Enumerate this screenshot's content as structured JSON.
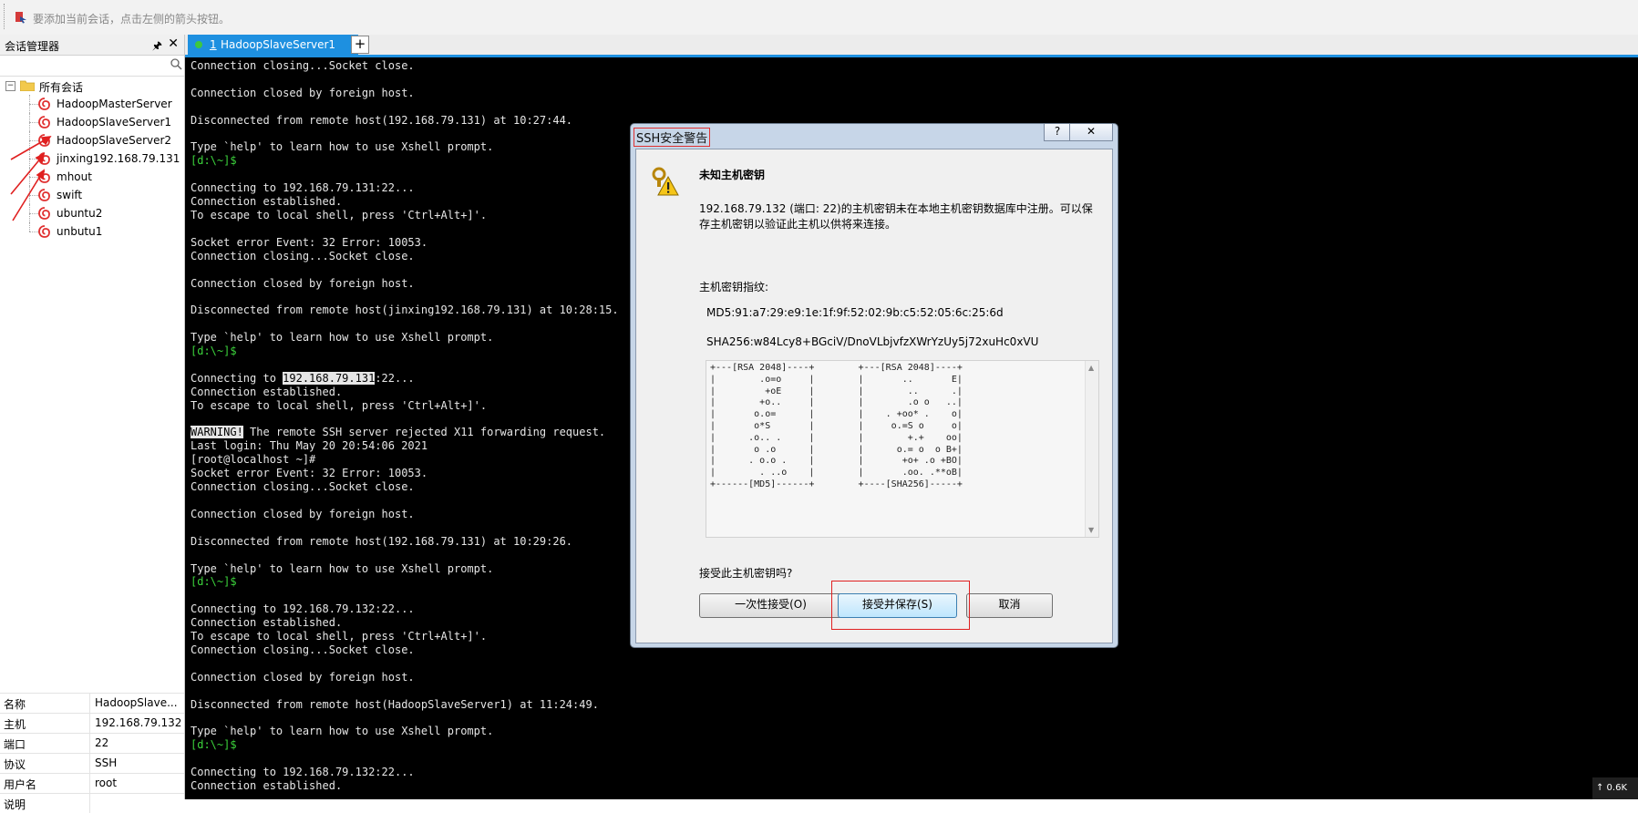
{
  "hint_bar": {
    "text": "要添加当前会话，点击左侧的箭头按钮。"
  },
  "session_manager": {
    "title": "会话管理器",
    "search_value": "",
    "tree": {
      "root_label": "所有会话",
      "root_expander": "−",
      "items": [
        {
          "label": "HadoopMasterServer"
        },
        {
          "label": "HadoopSlaveServer1"
        },
        {
          "label": "HadoopSlaveServer2"
        },
        {
          "label": "jinxing192.168.79.131"
        },
        {
          "label": "mhout"
        },
        {
          "label": "swift"
        },
        {
          "label": "ubuntu2"
        },
        {
          "label": "unbutu1"
        }
      ]
    },
    "properties": [
      {
        "key": "名称",
        "value": "HadoopSlave..."
      },
      {
        "key": "主机",
        "value": "192.168.79.132"
      },
      {
        "key": "端口",
        "value": "22"
      },
      {
        "key": "协议",
        "value": "SSH"
      },
      {
        "key": "用户名",
        "value": "root"
      },
      {
        "key": "说明",
        "value": ""
      }
    ]
  },
  "tabs": {
    "active": {
      "number": "1",
      "label": "HadoopSlaveServer1"
    },
    "add_label": "+"
  },
  "terminal": {
    "lines": [
      {
        "t": "Connection closing...Socket close."
      },
      {
        "t": ""
      },
      {
        "t": "Connection closed by foreign host."
      },
      {
        "t": ""
      },
      {
        "t": "Disconnected from remote host(192.168.79.131) at 10:27:44."
      },
      {
        "t": ""
      },
      {
        "t": "Type `help' to learn how to use Xshell prompt."
      },
      {
        "t": "[d:\\~]$",
        "prompt": true
      },
      {
        "t": ""
      },
      {
        "t": "Connecting to 192.168.79.131:22..."
      },
      {
        "t": "Connection established."
      },
      {
        "t": "To escape to local shell, press 'Ctrl+Alt+]'."
      },
      {
        "t": ""
      },
      {
        "t": "Socket error Event: 32 Error: 10053."
      },
      {
        "t": "Connection closing...Socket close."
      },
      {
        "t": ""
      },
      {
        "t": "Connection closed by foreign host."
      },
      {
        "t": ""
      },
      {
        "t": "Disconnected from remote host(jinxing192.168.79.131) at 10:28:15."
      },
      {
        "t": ""
      },
      {
        "t": "Type `help' to learn how to use Xshell prompt."
      },
      {
        "t": "[d:\\~]$",
        "prompt": true
      },
      {
        "t": ""
      },
      {
        "t": "Connecting to ",
        "hl": "192.168.79.131",
        "after": ":22..."
      },
      {
        "t": "Connection established."
      },
      {
        "t": "To escape to local shell, press 'Ctrl+Alt+]'."
      },
      {
        "t": ""
      },
      {
        "t": "",
        "hl": "WARNING!",
        "after": " The remote SSH server rejected X11 forwarding request."
      },
      {
        "t": "Last login: Thu May 20 20:54:06 2021"
      },
      {
        "t": "[root@localhost ~]#"
      },
      {
        "t": "Socket error Event: 32 Error: 10053."
      },
      {
        "t": "Connection closing...Socket close."
      },
      {
        "t": ""
      },
      {
        "t": "Connection closed by foreign host."
      },
      {
        "t": ""
      },
      {
        "t": "Disconnected from remote host(192.168.79.131) at 10:29:26."
      },
      {
        "t": ""
      },
      {
        "t": "Type `help' to learn how to use Xshell prompt."
      },
      {
        "t": "[d:\\~]$",
        "prompt": true
      },
      {
        "t": ""
      },
      {
        "t": "Connecting to 192.168.79.132:22..."
      },
      {
        "t": "Connection established."
      },
      {
        "t": "To escape to local shell, press 'Ctrl+Alt+]'."
      },
      {
        "t": "Connection closing...Socket close."
      },
      {
        "t": ""
      },
      {
        "t": "Connection closed by foreign host."
      },
      {
        "t": ""
      },
      {
        "t": "Disconnected from remote host(HadoopSlaveServer1) at 11:24:49."
      },
      {
        "t": ""
      },
      {
        "t": "Type `help' to learn how to use Xshell prompt."
      },
      {
        "t": "[d:\\~]$",
        "prompt": true
      },
      {
        "t": ""
      },
      {
        "t": "Connecting to 192.168.79.132:22..."
      },
      {
        "t": "Connection established."
      }
    ],
    "status_corner": "↑ 0.6K"
  },
  "dialog": {
    "title": "SSH安全警告",
    "help_label": "?",
    "close_label": "✕",
    "heading": "未知主机密钥",
    "message": "192.168.79.132 (端口: 22)的主机密钥未在本地主机密钥数据库中注册。可以保存主机密钥以验证此主机以供将来连接。",
    "fingerprint_label": "主机密钥指纹:",
    "md5": "MD5:91:a7:29:e9:1e:1f:9f:52:02:9b:c5:52:05:6c:25:6d",
    "sha256": "SHA256:w84Lcy8+BGciV/DnoVLbjvfzXWrYzUy5j72xuHc0xVU",
    "randomart": "+---[RSA 2048]----+        +---[RSA 2048]----+\n|        .o=o     |        |       ..       E|\n|         +oE     |        |        ..      .|\n|        +o..     |        |        .o o   ..|\n|       o.o=      |        |    . +oo* .    o|\n|       o*S       |        |     o.=S o     o|\n|      .o.. .     |        |        +.+    oo|\n|       o .o      |        |      o.= o  o B+|\n|      . o.o .    |        |       +o+ .o +BO|\n|        . ..o    |        |       .oo. .**oB|\n+------[MD5]------+        +----[SHA256]-----+",
    "question": "接受此主机密钥吗?",
    "buttons": {
      "once": "一次性接受(O)",
      "save": "接受并保存(S)",
      "cancel": "取消"
    }
  },
  "colors": {
    "accent_tab": "#1e90e0",
    "terminal_bg": "#000000",
    "prompt_green": "#3cd33c",
    "annotation_red": "#e02020"
  }
}
